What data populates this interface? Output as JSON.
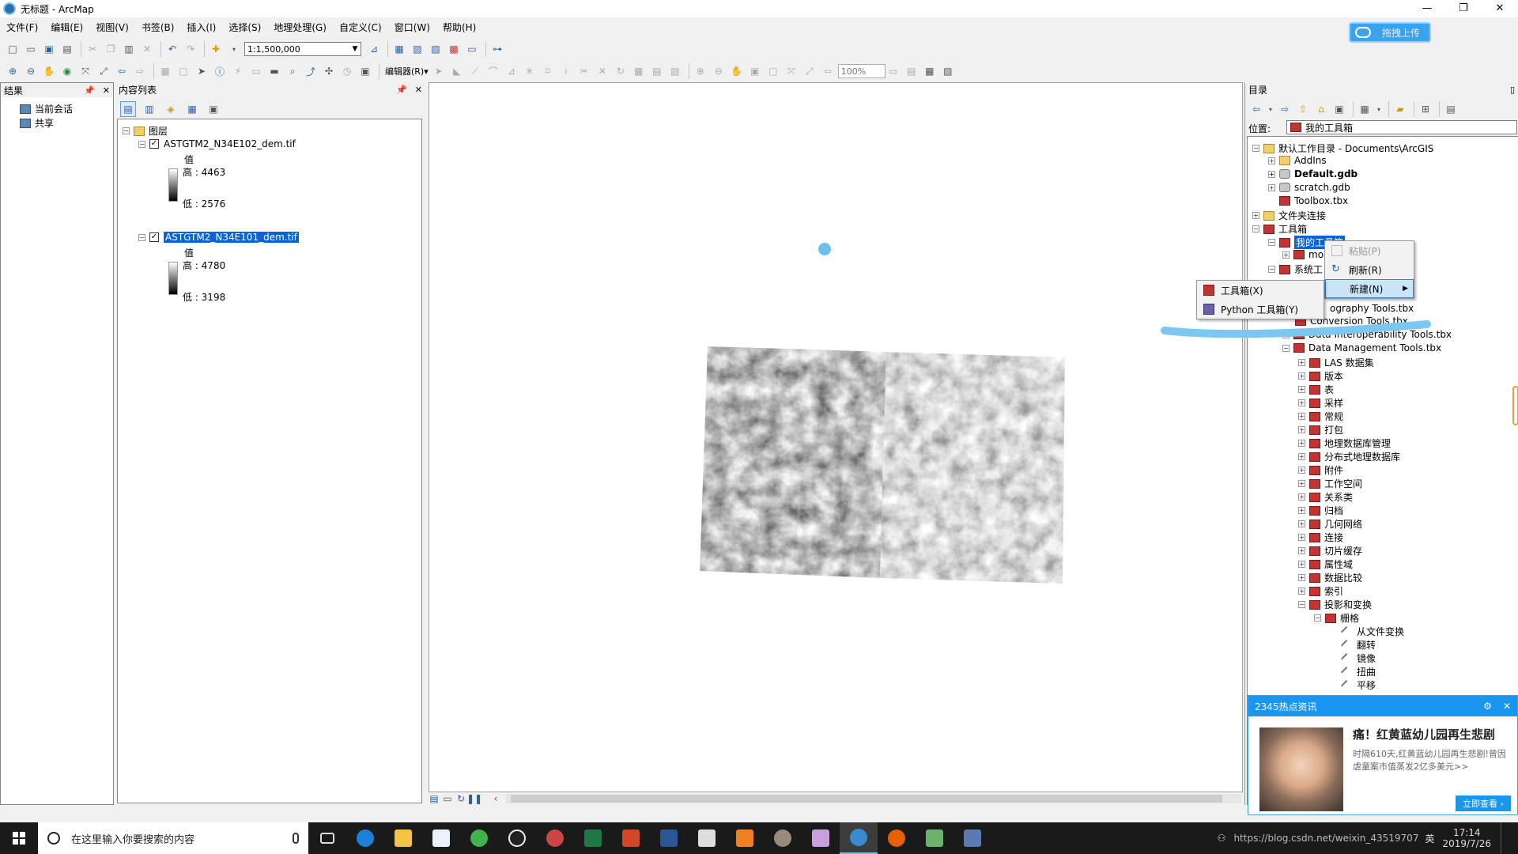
{
  "window": {
    "title": "无标题 - ArcMap",
    "controls": [
      "—",
      "❐",
      "✕"
    ]
  },
  "menu": [
    "文件(F)",
    "编辑(E)",
    "视图(V)",
    "书签(B)",
    "插入(I)",
    "选择(S)",
    "地理处理(G)",
    "自定义(C)",
    "窗口(W)",
    "帮助(H)"
  ],
  "upload_button": "拖拽上传",
  "toolbar": {
    "scale": "1:1,500,000",
    "editor": "编辑器(R)▾",
    "zoom": "100%"
  },
  "results_pane": {
    "title": "结果",
    "items": [
      "当前会话",
      "共享"
    ]
  },
  "toc": {
    "title": "内容列表",
    "root": "图层",
    "layers": [
      {
        "name": "ASTGTM2_N34E102_dem.tif",
        "value_label": "值",
        "high": "高 : 4463",
        "low": "低 : 2576"
      },
      {
        "name": "ASTGTM2_N34E101_dem.tif",
        "value_label": "值",
        "high": "高 : 4780",
        "low": "低 : 3198"
      }
    ]
  },
  "catalog": {
    "title": "目录",
    "location_label": "位置:",
    "location_value": "我的工具箱",
    "tree": [
      "默认工作目录 - Documents\\ArcGIS",
      "AddIns",
      "Default.gdb",
      "scratch.gdb",
      "Toolbox.tbx",
      "文件夹连接",
      "工具箱",
      "我的工具箱",
      "mo",
      "系统工",
      "ography Tools.tbx",
      "Conversion Tools.tbx",
      "Data Interoperability Tools.tbx",
      "Data Management Tools.tbx",
      "LAS 数据集",
      "版本",
      "表",
      "采样",
      "常规",
      "打包",
      "地理数据库管理",
      "分布式地理数据库",
      "附件",
      "工作空间",
      "关系类",
      "归档",
      "几何网络",
      "连接",
      "切片缓存",
      "属性域",
      "数据比较",
      "索引",
      "投影和变换",
      "栅格",
      "从文件变换",
      "翻转",
      "镜像",
      "扭曲",
      "平移"
    ]
  },
  "context_menu": {
    "paste": "粘贴(P)",
    "refresh": "刷新(R)",
    "new": "新建(N)"
  },
  "submenu": {
    "toolbox": "工具箱(X)",
    "python_toolbox": "Python 工具箱(Y)"
  },
  "news": {
    "header": "2345热点资讯",
    "headline": "痛！红黄蓝幼儿园再生悲剧",
    "body": "时隔610天,红黄蓝幼儿园再生悲剧!曾因虐童案市值蒸发2亿多美元>>",
    "button": "立即查看 ›"
  },
  "taskbar": {
    "search_placeholder": "在这里输入你要搜索的内容",
    "tray_text": "https://blog.csdn.net/weixin_43519707",
    "time": "17:14",
    "date": "2019/7/26",
    "lang": "英"
  }
}
